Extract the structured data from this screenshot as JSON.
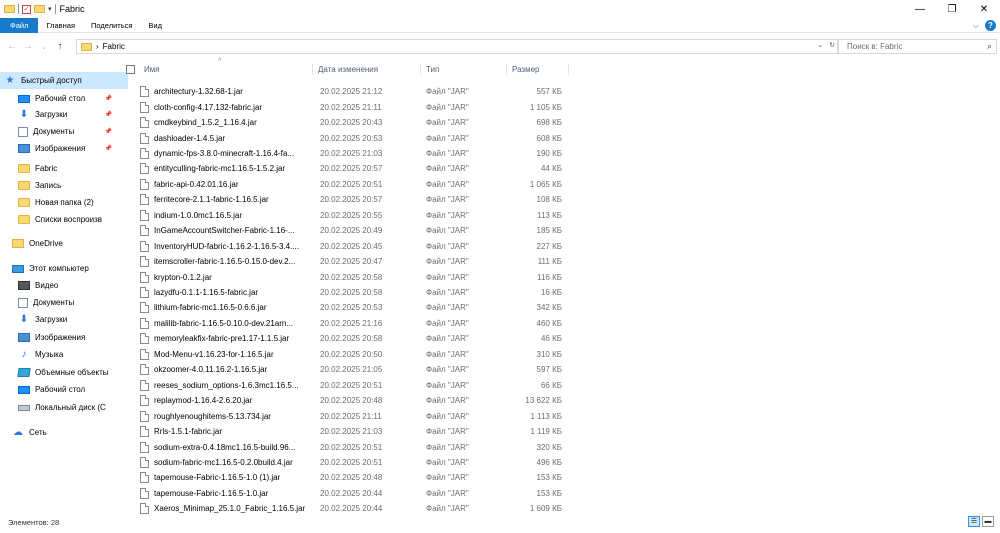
{
  "window": {
    "title": "Fabric",
    "controls": {
      "minimize": "—",
      "maximize": "❐",
      "close": "✕"
    }
  },
  "ribbon": {
    "tabs": [
      "Файл",
      "Главная",
      "Поделиться",
      "Вид"
    ]
  },
  "address": {
    "path": "Fabric",
    "search_placeholder": "Поиск в: Fabric"
  },
  "sidebar": {
    "items": [
      {
        "label": "Быстрый доступ",
        "icon": "star-icon",
        "pinned": false
      },
      {
        "label": "Рабочий стол",
        "icon": "desktop-icon",
        "pinned": true
      },
      {
        "label": "Загрузки",
        "icon": "downloads-icon",
        "pinned": true
      },
      {
        "label": "Документы",
        "icon": "documents-icon",
        "pinned": true
      },
      {
        "label": "Изображения",
        "icon": "pictures-icon",
        "pinned": true
      },
      {
        "label": "Fabric",
        "icon": "folder-icon",
        "pinned": false
      },
      {
        "label": "Запись",
        "icon": "folder-icon",
        "pinned": false
      },
      {
        "label": "Новая папка (2)",
        "icon": "folder-icon",
        "pinned": false
      },
      {
        "label": "Списки воспроизв",
        "icon": "folder-icon",
        "pinned": false
      },
      {
        "label": "OneDrive",
        "icon": "onedrive-icon",
        "pinned": false
      },
      {
        "label": "Этот компьютер",
        "icon": "computer-icon",
        "pinned": false
      },
      {
        "label": "Видео",
        "icon": "video-icon",
        "pinned": false
      },
      {
        "label": "Документы",
        "icon": "documents-icon",
        "pinned": false
      },
      {
        "label": "Загрузки",
        "icon": "downloads-icon",
        "pinned": false
      },
      {
        "label": "Изображения",
        "icon": "pictures-icon",
        "pinned": false
      },
      {
        "label": "Музыка",
        "icon": "music-icon",
        "pinned": false
      },
      {
        "label": "Объемные объекты",
        "icon": "3d-objects-icon",
        "pinned": false
      },
      {
        "label": "Рабочий стол",
        "icon": "desktop-icon",
        "pinned": false
      },
      {
        "label": "Локальный диск (C",
        "icon": "disk-icon",
        "pinned": false
      },
      {
        "label": "Сеть",
        "icon": "network-icon",
        "pinned": false
      }
    ]
  },
  "columns": {
    "name": "Имя",
    "date": "Дата изменения",
    "type": "Тип",
    "size": "Размер"
  },
  "files": [
    {
      "name": "architectury-1.32.68-1.jar",
      "date": "20.02.2025 21:12",
      "type": "Файл \"JAR\"",
      "size": "557 КБ"
    },
    {
      "name": "cloth-config-4.17.132-fabric.jar",
      "date": "20.02.2025 21:11",
      "type": "Файл \"JAR\"",
      "size": "1 105 КБ"
    },
    {
      "name": "cmdkeybind_1.5.2_1.16.4.jar",
      "date": "20.02.2025 20:43",
      "type": "Файл \"JAR\"",
      "size": "698 КБ"
    },
    {
      "name": "dashloader-1.4.5.jar",
      "date": "20.02.2025 20:53",
      "type": "Файл \"JAR\"",
      "size": "608 КБ"
    },
    {
      "name": "dynamic-fps-3.8.0-minecraft-1.16.4-fa...",
      "date": "20.02.2025 21:03",
      "type": "Файл \"JAR\"",
      "size": "190 КБ"
    },
    {
      "name": "entityculling-fabric-mc1.16.5-1.5.2.jar",
      "date": "20.02.2025 20:57",
      "type": "Файл \"JAR\"",
      "size": "44 КБ"
    },
    {
      "name": "fabric-api-0.42.01.16.jar",
      "date": "20.02.2025 20:51",
      "type": "Файл \"JAR\"",
      "size": "1 065 КБ"
    },
    {
      "name": "ferritecore-2.1.1-fabric-1.16.5.jar",
      "date": "20.02.2025 20:57",
      "type": "Файл \"JAR\"",
      "size": "108 КБ"
    },
    {
      "name": "indium-1.0.0mc1.16.5.jar",
      "date": "20.02.2025 20:55",
      "type": "Файл \"JAR\"",
      "size": "113 КБ"
    },
    {
      "name": "InGameAccountSwitcher-Fabric-1.16-...",
      "date": "20.02.2025 20:49",
      "type": "Файл \"JAR\"",
      "size": "185 КБ"
    },
    {
      "name": "InventoryHUD-fabric-1.16.2-1.16.5-3.4....",
      "date": "20.02.2025 20:45",
      "type": "Файл \"JAR\"",
      "size": "227 КБ"
    },
    {
      "name": "itemscroller-fabric-1.16.5-0.15.0-dev.2...",
      "date": "20.02.2025 20:47",
      "type": "Файл \"JAR\"",
      "size": "111 КБ"
    },
    {
      "name": "krypton-0.1.2.jar",
      "date": "20.02.2025 20:58",
      "type": "Файл \"JAR\"",
      "size": "116 КБ"
    },
    {
      "name": "lazydfu-0.1.1-1.16.5-fabric.jar",
      "date": "20.02.2025 20:58",
      "type": "Файл \"JAR\"",
      "size": "16 КБ"
    },
    {
      "name": "lithium-fabric-mc1.16.5-0.6.6.jar",
      "date": "20.02.2025 20:53",
      "type": "Файл \"JAR\"",
      "size": "342 КБ"
    },
    {
      "name": "malilib-fabric-1.16.5-0.10.0-dev.21arn...",
      "date": "20.02.2025 21:16",
      "type": "Файл \"JAR\"",
      "size": "460 КБ"
    },
    {
      "name": "memoryleakfix-fabric-pre1.17-1.1.5.jar",
      "date": "20.02.2025 20:58",
      "type": "Файл \"JAR\"",
      "size": "46 КБ"
    },
    {
      "name": "Mod-Menu-v1.16.23-for-1.16.5.jar",
      "date": "20.02.2025 20:50",
      "type": "Файл \"JAR\"",
      "size": "310 КБ"
    },
    {
      "name": "okzoomer-4.0.11.16.2-1.16.5.jar",
      "date": "20.02.2025 21:05",
      "type": "Файл \"JAR\"",
      "size": "597 КБ"
    },
    {
      "name": "reeses_sodium_options-1.6.3mc1.16.5...",
      "date": "20.02.2025 20:51",
      "type": "Файл \"JAR\"",
      "size": "66 КБ"
    },
    {
      "name": "replaymod-1.16.4-2.6.20.jar",
      "date": "20.02.2025 20:48",
      "type": "Файл \"JAR\"",
      "size": "13 622 КБ"
    },
    {
      "name": "roughlyenoughitems-5.13.734.jar",
      "date": "20.02.2025 21:11",
      "type": "Файл \"JAR\"",
      "size": "1 113 КБ"
    },
    {
      "name": "Rrls-1.5.1-fabric.jar",
      "date": "20.02.2025 21:03",
      "type": "Файл \"JAR\"",
      "size": "1 119 КБ"
    },
    {
      "name": "sodium-extra-0.4.18mc1.16.5-build.96...",
      "date": "20.02.2025 20:51",
      "type": "Файл \"JAR\"",
      "size": "320 КБ"
    },
    {
      "name": "sodium-fabric-mc1.16.5-0.2.0build.4.jar",
      "date": "20.02.2025 20:51",
      "type": "Файл \"JAR\"",
      "size": "496 КБ"
    },
    {
      "name": "tapemouse-Fabric-1.16.5-1.0 (1).jar",
      "date": "20.02.2025 20:48",
      "type": "Файл \"JAR\"",
      "size": "153 КБ"
    },
    {
      "name": "tapemouse-Fabric-1.16.5-1.0.jar",
      "date": "20.02.2025 20:44",
      "type": "Файл \"JAR\"",
      "size": "153 КБ"
    },
    {
      "name": "Xaeros_Minimap_25.1.0_Fabric_1.16.5.jar",
      "date": "20.02.2025 20:44",
      "type": "Файл \"JAR\"",
      "size": "1 609 КБ"
    }
  ],
  "status": {
    "count": "Элементов: 28"
  }
}
